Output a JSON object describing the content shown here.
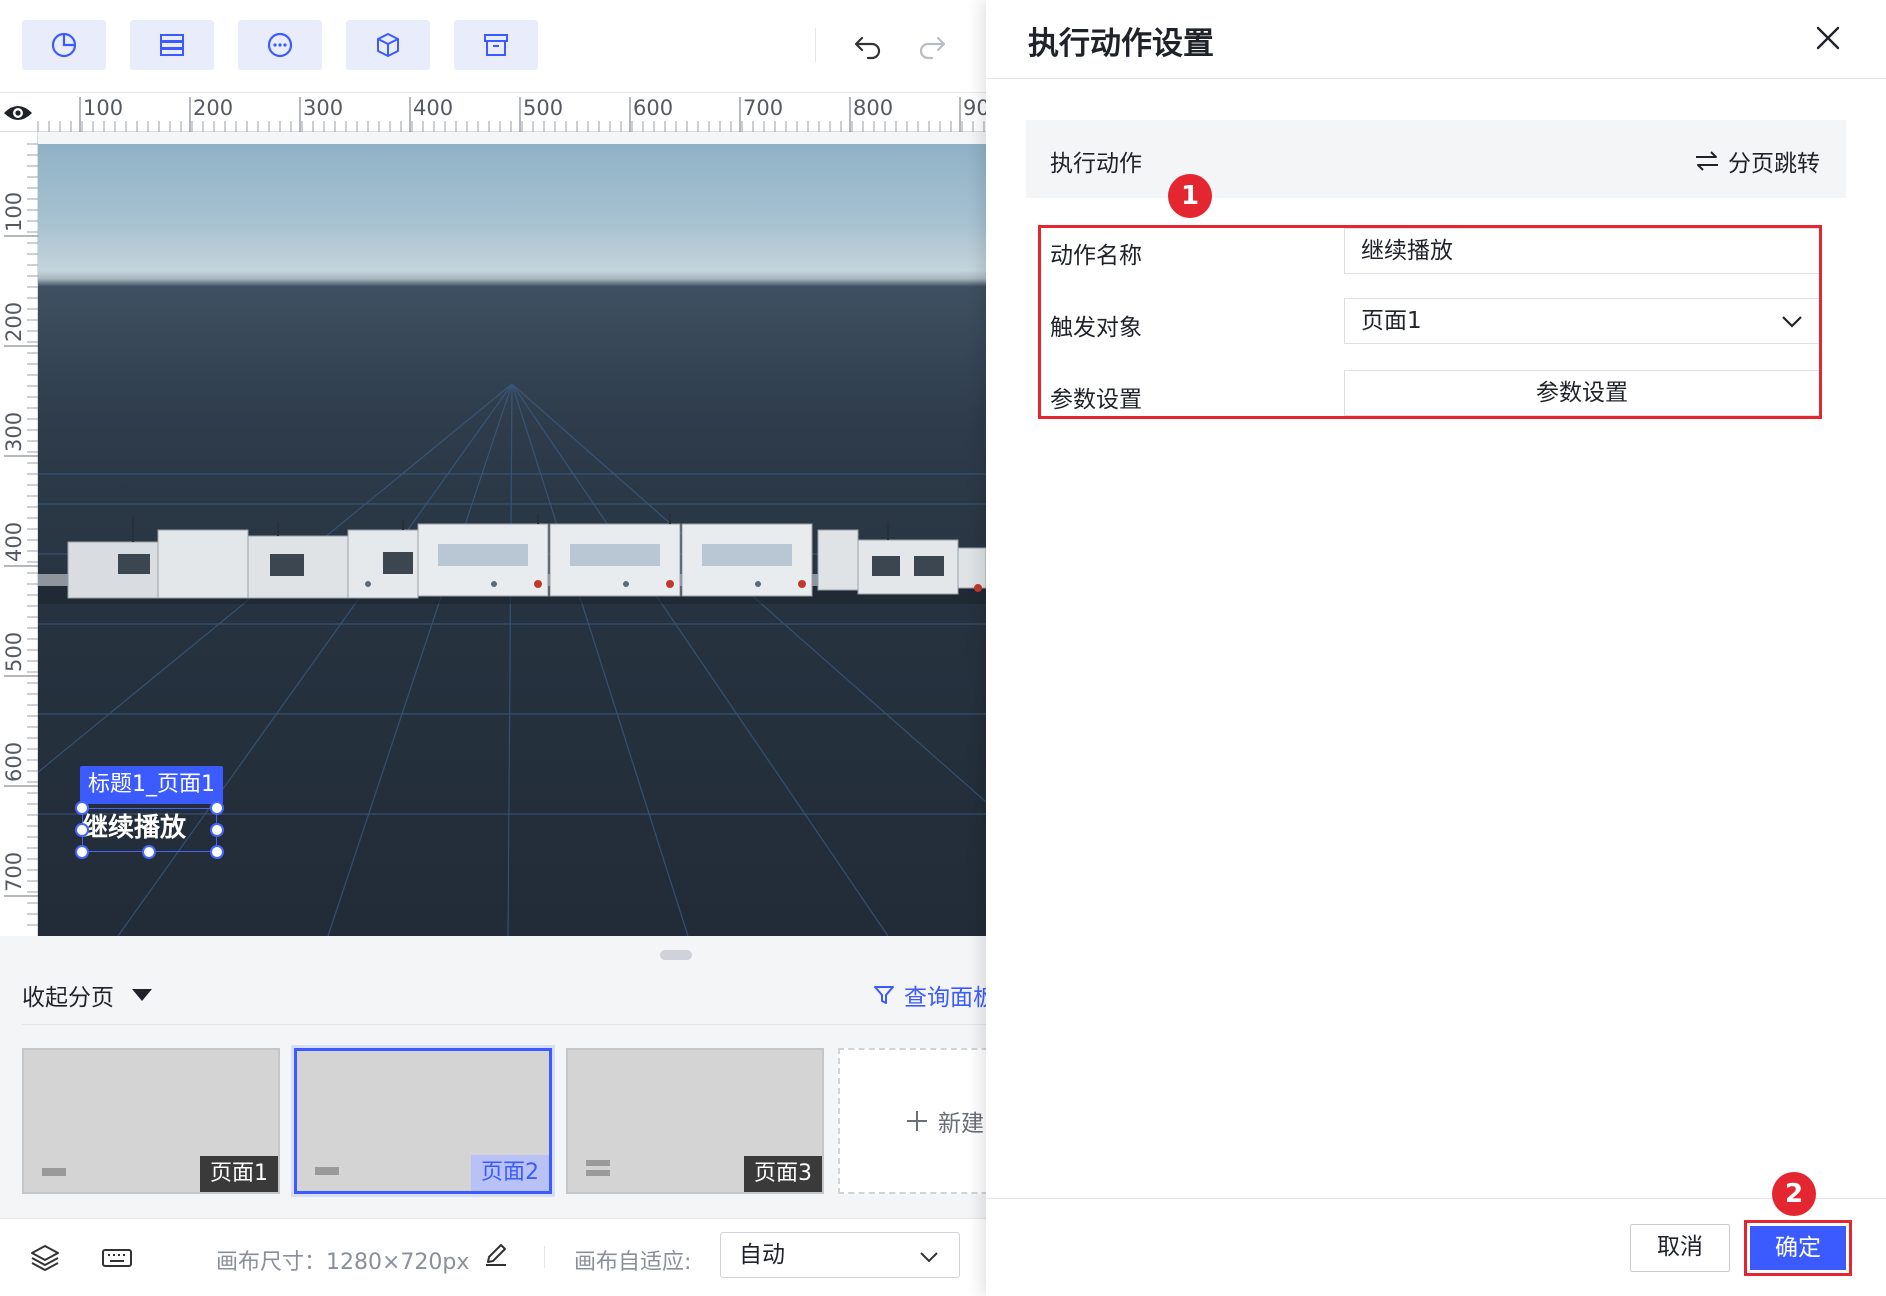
{
  "toolbar": {
    "tools": [
      {
        "icon": "chart-icon"
      },
      {
        "icon": "list-icon"
      },
      {
        "icon": "more-circle-icon"
      },
      {
        "icon": "cube-icon"
      },
      {
        "icon": "archive-icon"
      }
    ],
    "undo_icon": "undo-icon",
    "redo_icon": "redo-icon"
  },
  "ruler": {
    "top_ticks": [
      "100",
      "200",
      "300",
      "400",
      "500",
      "600",
      "700",
      "800",
      "90"
    ],
    "left_ticks": [
      "100",
      "200",
      "300",
      "400",
      "500",
      "600",
      "700"
    ]
  },
  "canvas": {
    "selected_component_label": "标题1_页面1",
    "selected_component_text": "继续播放"
  },
  "pages_panel": {
    "collapse_label": "收起分页",
    "query_panel_label": "查询面板",
    "pages": [
      {
        "label": "页面1",
        "active": false
      },
      {
        "label": "页面2",
        "active": true
      },
      {
        "label": "页面3",
        "active": false
      }
    ],
    "new_page_label": "新建"
  },
  "bottom_bar": {
    "canvas_size_label": "画布尺寸：1280×720px",
    "adapt_label": "画布自适应:",
    "adapt_value": "自动"
  },
  "drawer": {
    "title": "执行动作设置",
    "action_label": "执行动作",
    "action_type": "分页跳转",
    "fields": {
      "name_label": "动作名称",
      "name_value": "继续播放",
      "target_label": "触发对象",
      "target_value": "页面1",
      "params_label": "参数设置",
      "params_button": "参数设置"
    },
    "badges": [
      "1",
      "2"
    ],
    "cancel_label": "取消",
    "confirm_label": "确定"
  },
  "colors": {
    "primary": "#3b5bff",
    "highlight_red": "#e3262f",
    "tool_bg": "#e9edfb"
  }
}
